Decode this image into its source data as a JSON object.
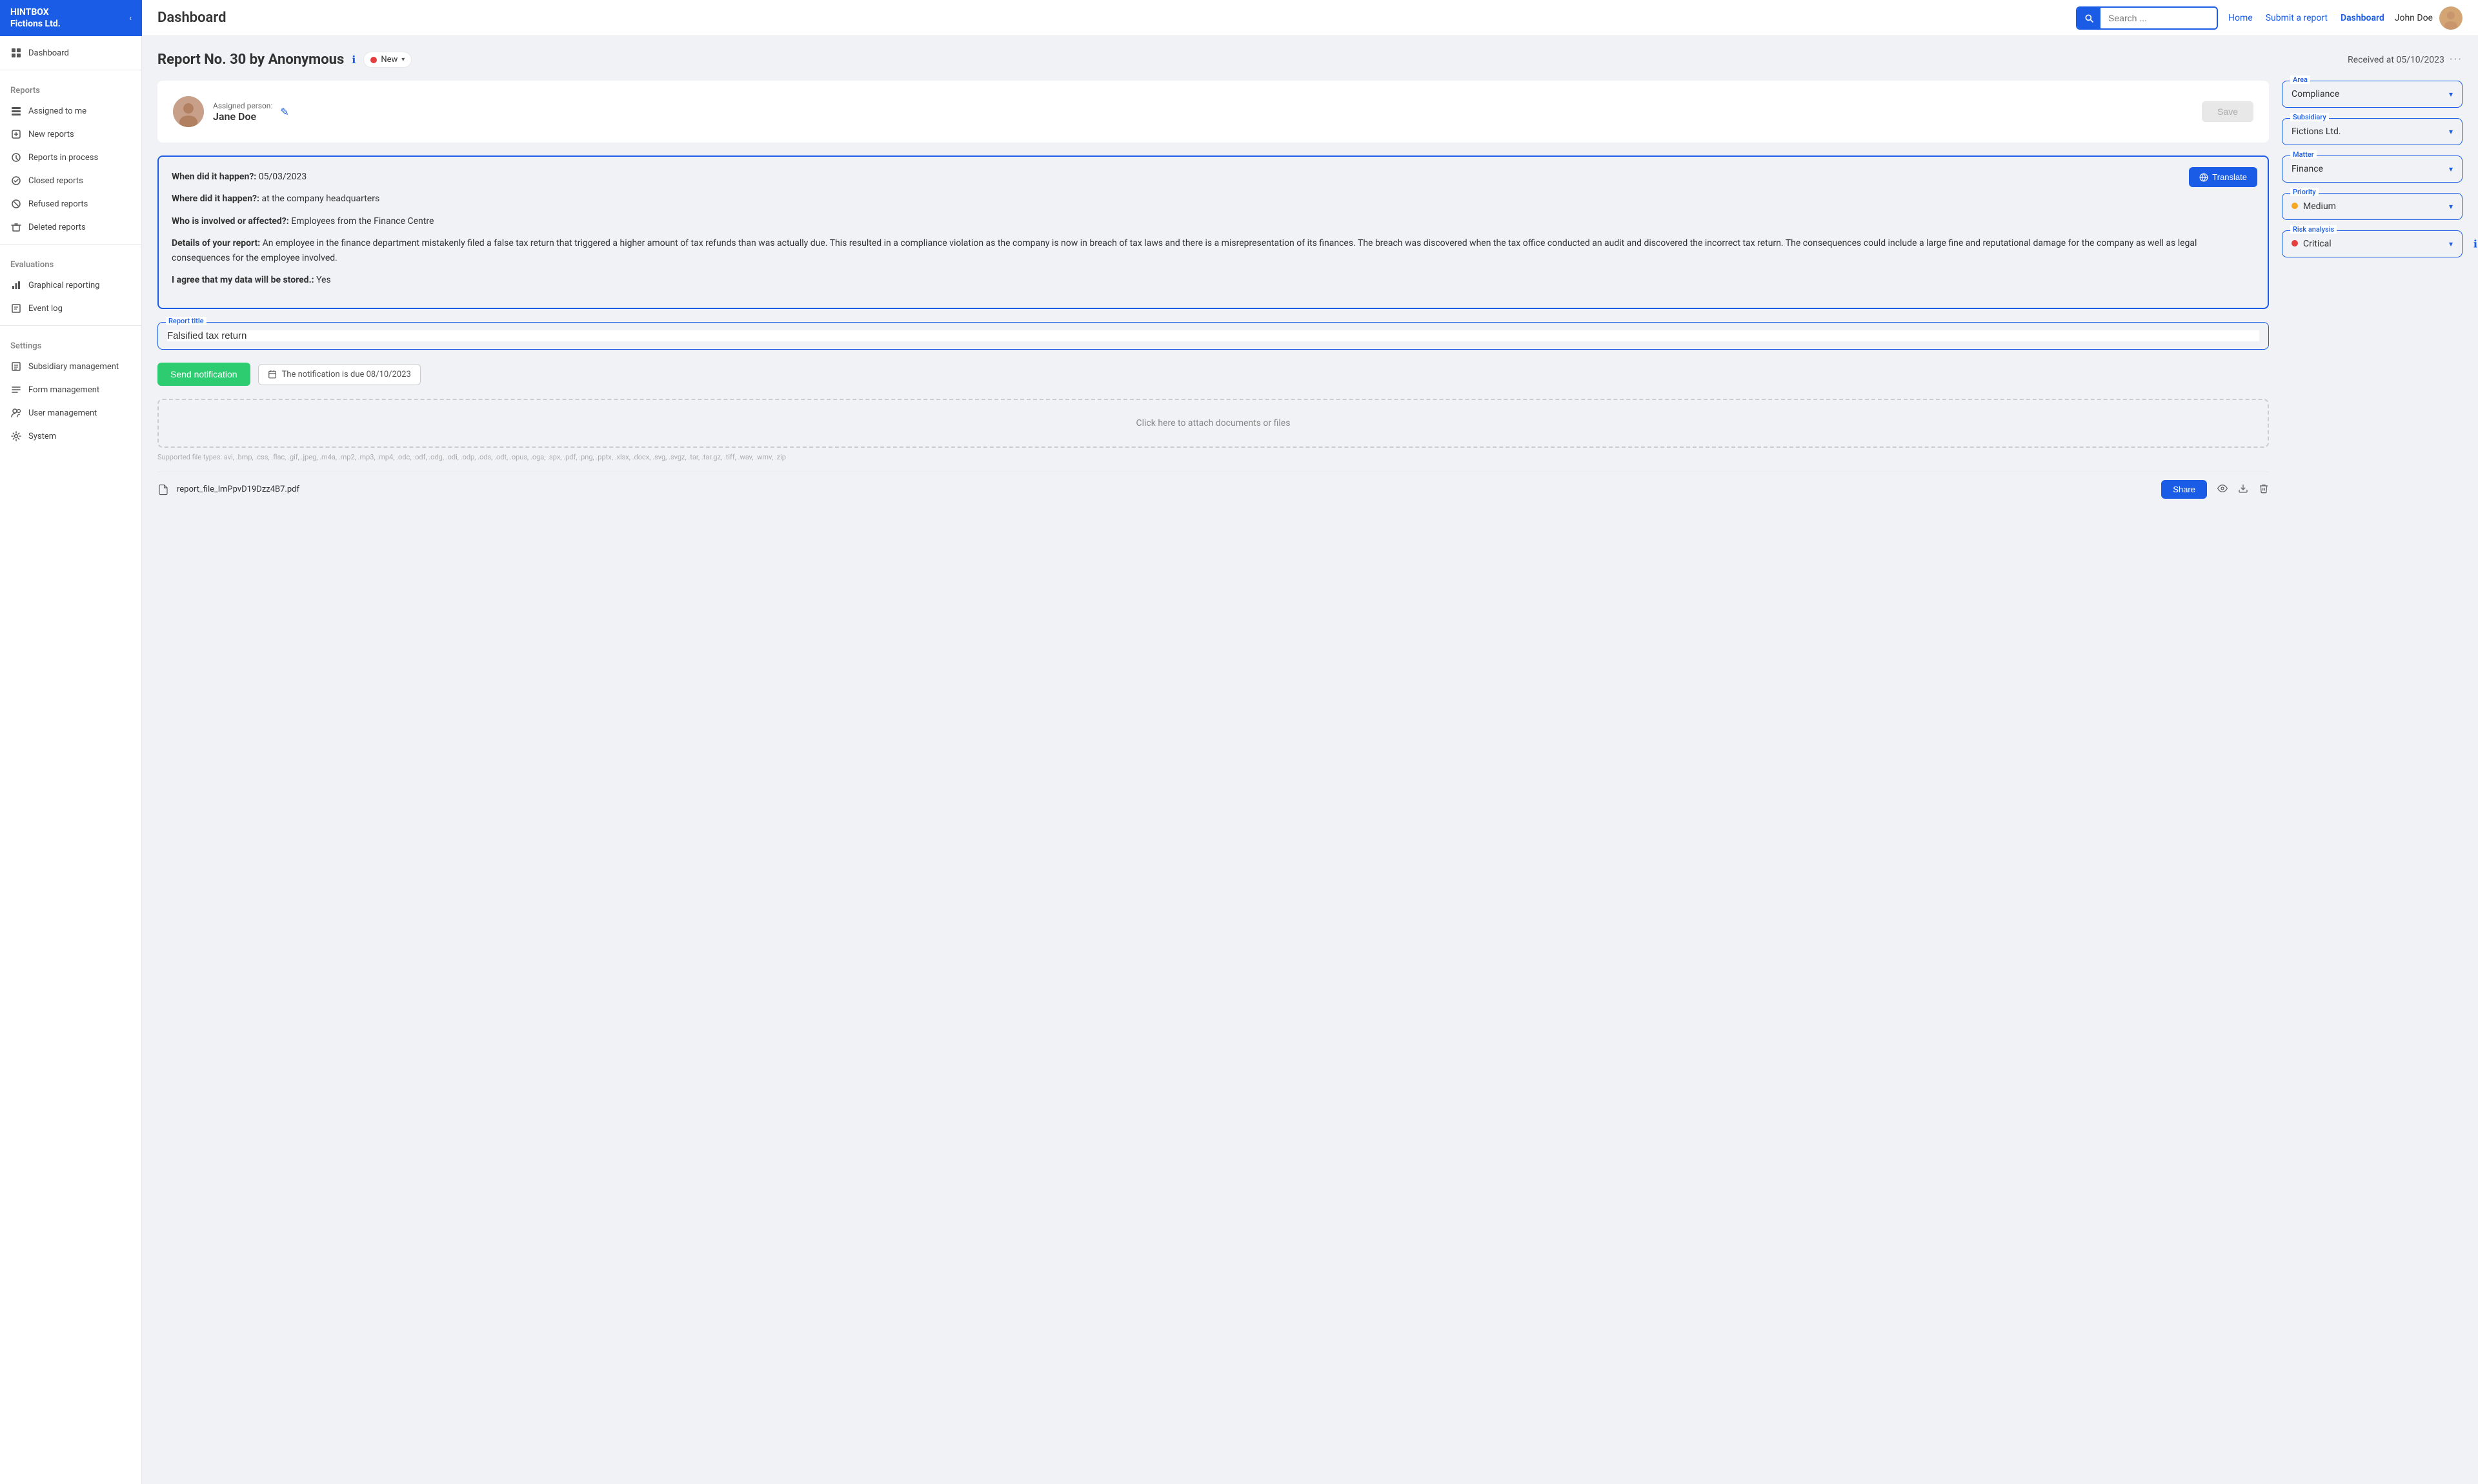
{
  "brand": {
    "name": "HINTBOX\nFictions Ltd.",
    "toggle_label": "‹"
  },
  "topbar": {
    "page_title": "Dashboard",
    "search_placeholder": "Search ...",
    "nav": [
      {
        "label": "Home",
        "active": false
      },
      {
        "label": "Submit a report",
        "active": false
      },
      {
        "label": "Dashboard",
        "active": true
      }
    ],
    "user_name": "John Doe"
  },
  "sidebar": {
    "sections": [
      {
        "label": "",
        "items": [
          {
            "icon": "grid-icon",
            "label": "Dashboard",
            "active": false
          }
        ]
      },
      {
        "label": "Reports",
        "items": [
          {
            "icon": "assigned-icon",
            "label": "Assigned to me",
            "active": false
          },
          {
            "icon": "new-reports-icon",
            "label": "New reports",
            "active": false
          },
          {
            "icon": "process-icon",
            "label": "Reports in process",
            "active": false
          },
          {
            "icon": "closed-icon",
            "label": "Closed reports",
            "active": false
          },
          {
            "icon": "refused-icon",
            "label": "Refused reports",
            "active": false
          },
          {
            "icon": "deleted-icon",
            "label": "Deleted reports",
            "active": false
          }
        ]
      },
      {
        "label": "Evaluations",
        "items": [
          {
            "icon": "chart-icon",
            "label": "Graphical reporting",
            "active": false
          },
          {
            "icon": "log-icon",
            "label": "Event log",
            "active": false
          }
        ]
      },
      {
        "label": "Settings",
        "items": [
          {
            "icon": "subsidiary-icon",
            "label": "Subsidiary management",
            "active": false
          },
          {
            "icon": "form-icon",
            "label": "Form management",
            "active": false
          },
          {
            "icon": "user-icon",
            "label": "User management",
            "active": false
          },
          {
            "icon": "system-icon",
            "label": "System",
            "active": false
          }
        ]
      }
    ]
  },
  "report": {
    "title": "Report No. 30 by Anonymous",
    "status": "New",
    "received": "Received at 05/10/2023",
    "assigned_label": "Assigned person:",
    "assigned_name": "Jane Doe",
    "fields": {
      "when": {
        "label": "When did it happen?:",
        "value": "05/03/2023"
      },
      "where": {
        "label": "Where did it happen?:",
        "value": "at the company headquarters"
      },
      "who": {
        "label": "Who is involved or affected?:",
        "value": "Employees from the Finance Centre"
      },
      "details_label": "Details of your report:",
      "details_value": "An employee in the finance department mistakenly filed a false tax return that triggered a higher amount of tax refunds than was actually due. This resulted in a compliance violation as the company is now in breach of tax laws and there is a misrepresentation of its finances. The breach was discovered when the tax office conducted an audit and discovered the incorrect tax return. The consequences could include a large fine and reputational damage for the company as well as legal consequences for the employee involved.",
      "consent_label": "I agree that my data will be stored.:",
      "consent_value": "Yes"
    },
    "report_title_label": "Report title",
    "report_title_value": "Falsified tax return",
    "translate_btn": "Translate",
    "save_btn": "Save",
    "send_notification_btn": "Send notification",
    "notification_due_label": "The notification is due 08/10/2023",
    "file_upload_label": "Click here to attach documents or files",
    "file_types": "Supported file types: avi, .bmp, .css, .flac, .gif, .jpeg, .m4a, .mp2, .mp3, .mp4, .odc, .odf, .odg, .odi, .odp, .ods, .odt, .opus, .oga, .spx, .pdf, .png, .pptx, .xlsx, .docx, .svg, .svgz, .tar, .tar.gz, .tiff, .wav, .wmv, .zip",
    "file_name": "report_file_lmPpvD19Dzz4B7.pdf",
    "share_btn": "Share"
  },
  "right_panel": {
    "area_label": "Area",
    "area_value": "Compliance",
    "subsidiary_label": "Subsidiary",
    "subsidiary_value": "Fictions Ltd.",
    "matter_label": "Matter",
    "matter_value": "Finance",
    "priority_label": "Priority",
    "priority_value": "Medium",
    "risk_label": "Risk analysis",
    "risk_value": "Critical"
  }
}
